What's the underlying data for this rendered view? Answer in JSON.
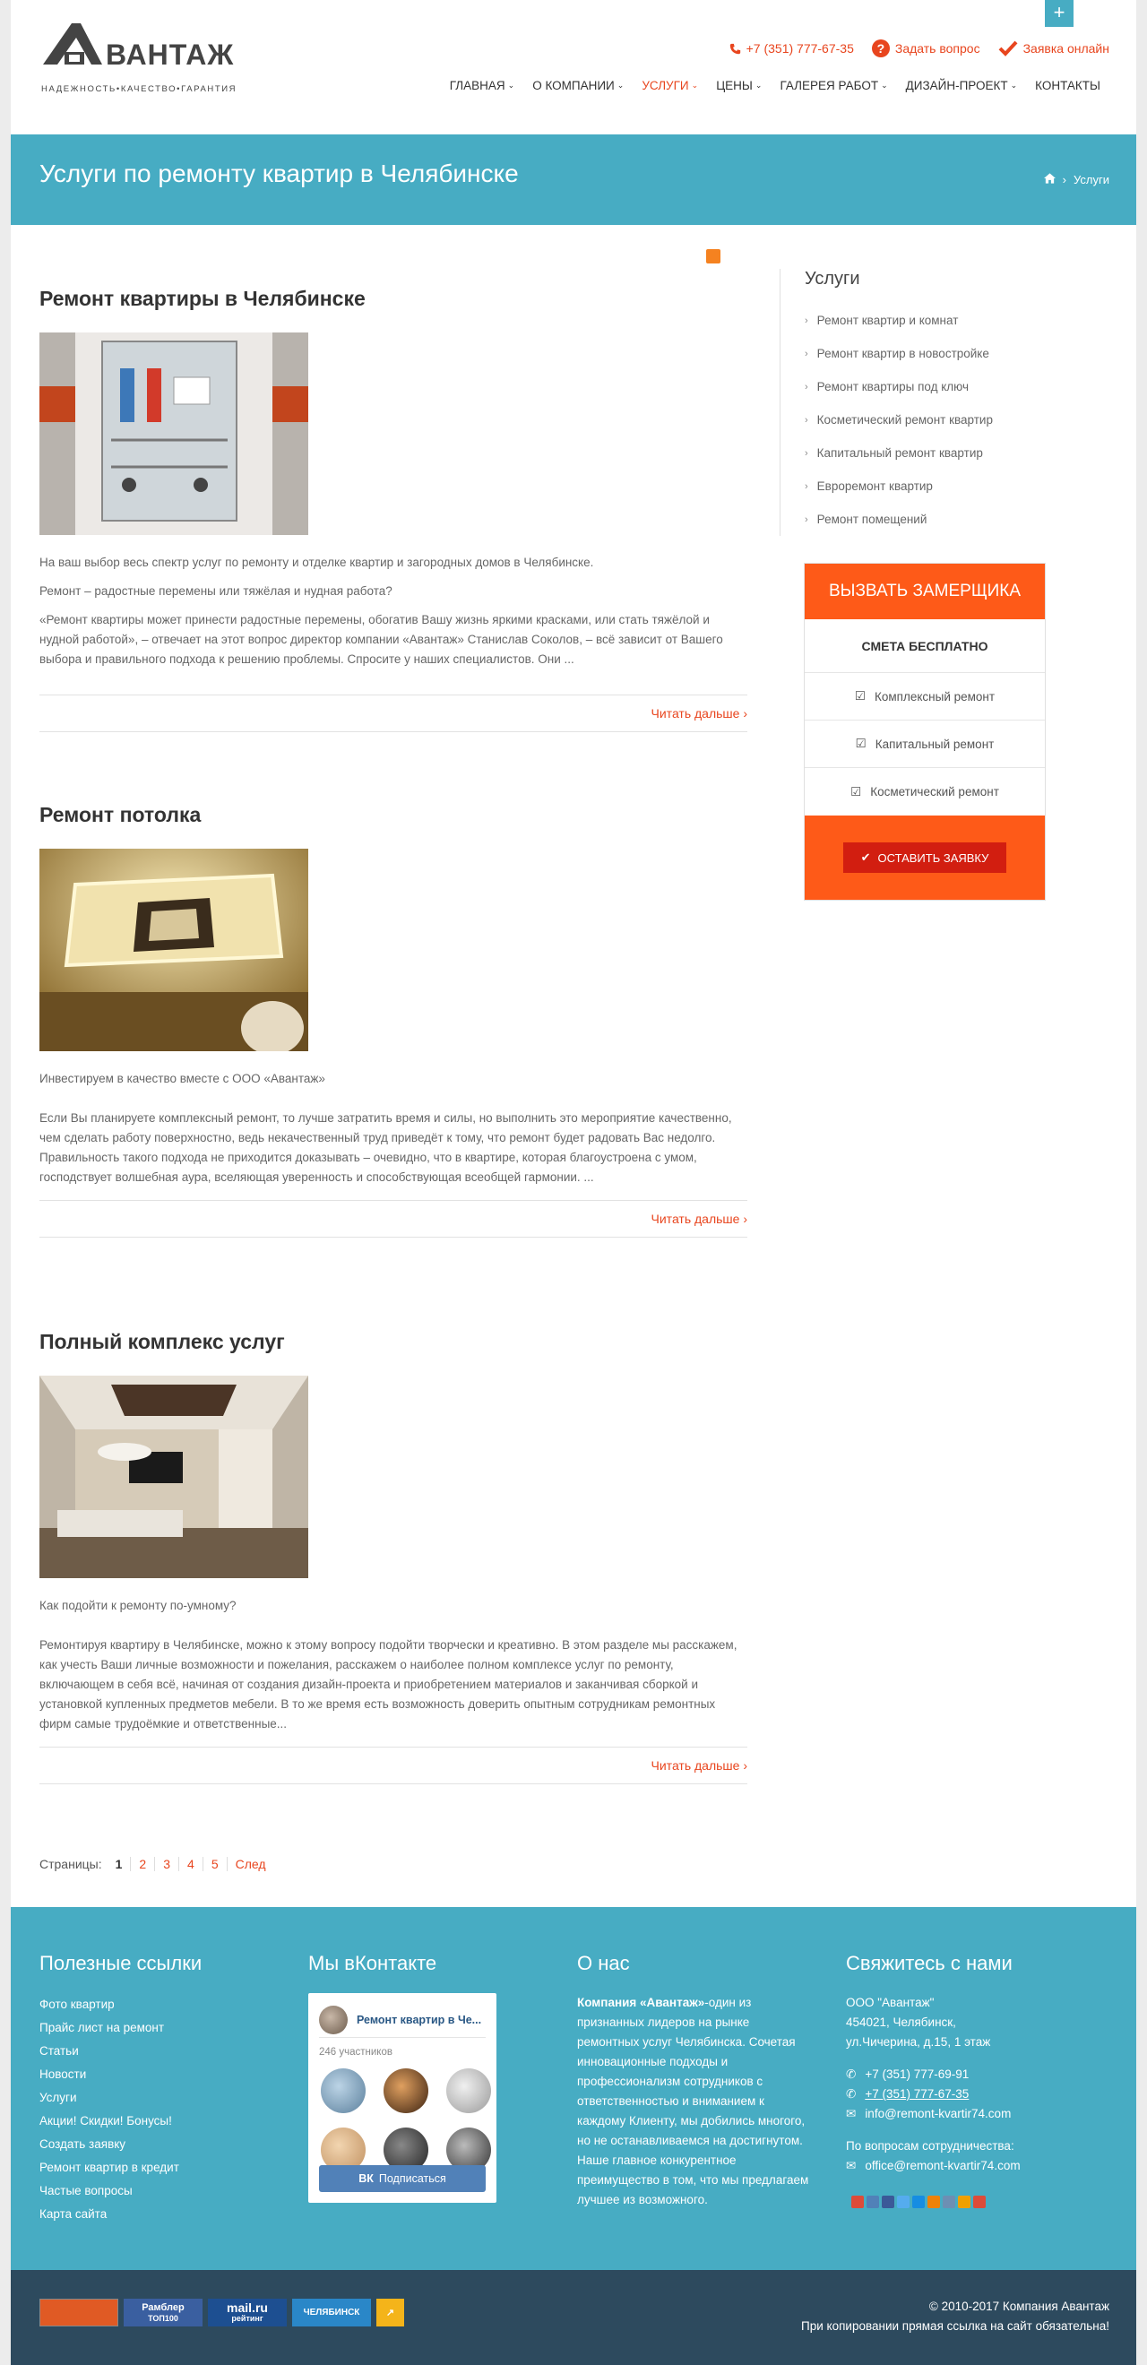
{
  "header": {
    "logo_text": "Авантаж",
    "logo_tagline": "НАДЕЖНОСТЬ•КАЧЕСТВО•ГАРАНТИЯ",
    "phone": "+7 (351) 777-67-35",
    "ask_question": "Задать вопрос",
    "online_request": "Заявка онлайн",
    "plus_label": "+"
  },
  "nav": [
    {
      "label": "ГЛАВНАЯ",
      "caret": true
    },
    {
      "label": "О КОМПАНИИ",
      "caret": true
    },
    {
      "label": "УСЛУГИ",
      "caret": true,
      "active": true
    },
    {
      "label": "ЦЕНЫ",
      "caret": true
    },
    {
      "label": "ГАЛЕРЕЯ РАБОТ",
      "caret": true
    },
    {
      "label": "ДИЗАЙН-ПРОЕКТ",
      "caret": true
    },
    {
      "label": "КОНТАКТЫ",
      "caret": false
    }
  ],
  "titlebar": {
    "title": "Услуги по ремонту квартир в Челябинске",
    "breadcrumb_current": "Услуги"
  },
  "posts": [
    {
      "title": "Ремонт квартиры в Челябинске",
      "paragraphs": [
        "На ваш выбор весь спектр услуг по ремонту и отделке квартир и загородных домов в Челябинске.",
        "Ремонт – радостные перемены или тяжёлая и нудная работа?",
        "«Ремонт квартиры может принести радостные перемены, обогатив Вашу жизнь яркими красками, или стать тяжёлой и нудной работой», – отвечает на этот вопрос директор компании «Авантаж» Станислав Соколов, – всё зависит от Вашего выбора и правильного подхода к решению проблемы. Спросите у наших специалистов. Они ..."
      ],
      "readmore": "Читать дальше ›"
    },
    {
      "title": "Ремонт потолка",
      "paragraphs": [
        "Инвестируем в качество вместе с  ООО «Авантаж»",
        "Если Вы планируете комплексный ремонт, то лучше затратить время и силы, но выполнить это мероприятие качественно, чем сделать работу поверхностно, ведь некачественный труд приведёт к тому, что ремонт будет радовать Вас недолго. Правильность такого подхода не приходится доказывать – очевидно, что в квартире, которая благоустроена с умом, господствует волшебная аура, вселяющая уверенность и способствующая всеобщей гармонии.    ..."
      ],
      "readmore": "Читать дальше ›"
    },
    {
      "title": "Полный комплекс услуг",
      "paragraphs": [
        "Как подойти к ремонту по-умному?",
        "Ремонтируя квартиру в Челябинске, можно к этому вопросу подойти творчески и креативно. В этом разделе мы расскажем, как учесть Ваши личные возможности и пожелания, расскажем о наиболее полном комплексе услуг по ремонту, включающем в себя всё, начиная от создания дизайн-проекта и приобретением материалов и заканчивая сборкой и установкой купленных предметов мебели. В то же время есть возможность доверить опытным сотрудникам ремонтных фирм самые трудоёмкие и ответственные..."
      ],
      "readmore": "Читать дальше ›"
    }
  ],
  "pager": {
    "label": "Страницы:",
    "pages": [
      "1",
      "2",
      "3",
      "4",
      "5",
      "След"
    ]
  },
  "sidebar": {
    "title": "Услуги",
    "items": [
      "Ремонт квартир и комнат",
      "Ремонт квартир в новостройке",
      "Ремонт квартиры под ключ",
      "Косметический ремонт квартир",
      "Капитальный ремонт квартир",
      "Евроремонт квартир",
      "Ремонт помещений"
    ]
  },
  "promo": {
    "title": "ВЫЗВАТЬ ЗАМЕРЩИКА",
    "subtitle": "СМЕТА БЕСПЛАТНО",
    "items": [
      "Комплексный ремонт",
      "Капитальный ремонт",
      "Косметический ремонт"
    ],
    "button": "ОСТАВИТЬ ЗАЯВКУ"
  },
  "footer": {
    "links_title": "Полезные ссылки",
    "links": [
      "Фото квартир",
      "Прайс лист на ремонт",
      "Статьи",
      "Новости",
      "Услуги",
      "Акции! Скидки! Бонусы!",
      "Создать заявку",
      "Ремонт квартир в кредит",
      "Частые вопросы",
      "Карта сайта"
    ],
    "vk_title": "Мы вКонтакте",
    "vk_group": "Ремонт квартир в Че...",
    "vk_members": "246 участников",
    "vk_subscribe": "Подписаться",
    "about_title": "О нас",
    "about_bold": "Компания «Авантаж»",
    "about_text": "-один из признанных лидеров на рынке ремонтных услуг Челябинска. Сочетая инновационные подходы и профессионализм сотрудников с ответственностью и вниманием к каждому Клиенту, мы добились многого, но не останавливаемся на достигнутом. Наше главное конкурентное преимущество в том, что мы предлагаем лучшее из возможного.",
    "contact_title": "Свяжитесь с нами",
    "company": "ООО \"Авантаж\"",
    "address1": "454021, Челябинск,",
    "address2": "ул.Чичерина, д.15, 1 этаж",
    "phone1": "+7 (351) 777-69-91",
    "phone2": "+7 (351) 777-67-35",
    "email1": "info@remont-kvartir74.com",
    "coop_label": "По вопросам сотрудничества:",
    "email2": "office@remont-kvartir74.com"
  },
  "bottom": {
    "copyright": "© 2010-2017 Компания Авантаж",
    "notice": "При копировании прямая ссылка на сайт обязательна!",
    "counter_rambler": "Рамблер",
    "counter_rambler_sub": "ТОП100",
    "counter_mail": "mail.ru",
    "counter_mail_sub": "рейтинг",
    "counter_chel": "ЧЕЛЯБИНСК"
  },
  "colors": {
    "accent": "#47acc3",
    "orange": "#e8451e",
    "promo": "#fe5a18",
    "dark": "#2d4a5e"
  }
}
